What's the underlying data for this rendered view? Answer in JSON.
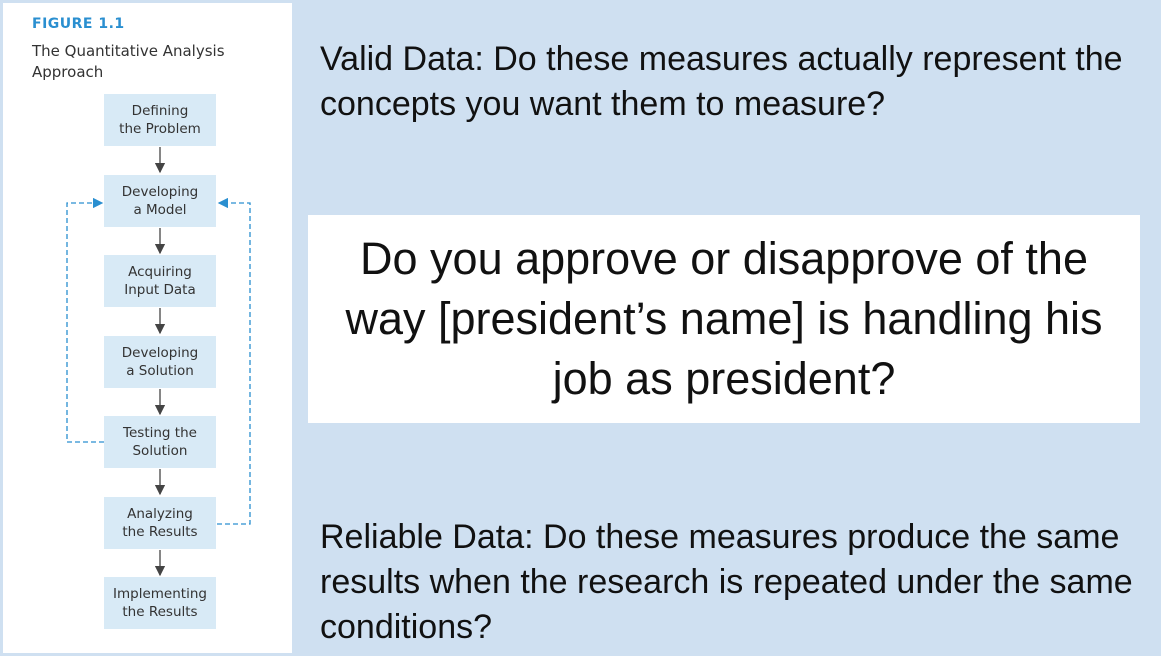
{
  "figure": {
    "label": "FIGURE 1.1",
    "title": "The Quantitative Analysis Approach",
    "steps": [
      "Defining\nthe Problem",
      "Developing\na Model",
      "Acquiring\nInput Data",
      "Developing\na Solution",
      "Testing the\nSolution",
      "Analyzing\nthe Results",
      "Implementing\nthe Results"
    ],
    "colors": {
      "accent": "#2a8fd0",
      "box_fill": "#d8eaf6",
      "feedback_line": "#2a8fd0"
    }
  },
  "slide": {
    "valid_data": "Valid Data: Do these measures actually represent the concepts you want them to measure?",
    "question": "Do you approve or disapprove of the way [president’s name] is handling his job as president?",
    "reliable_data": "Reliable Data: Do these measures produce the same results when the research is repeated under the same conditions?",
    "background_color": "#cfe0f1"
  }
}
